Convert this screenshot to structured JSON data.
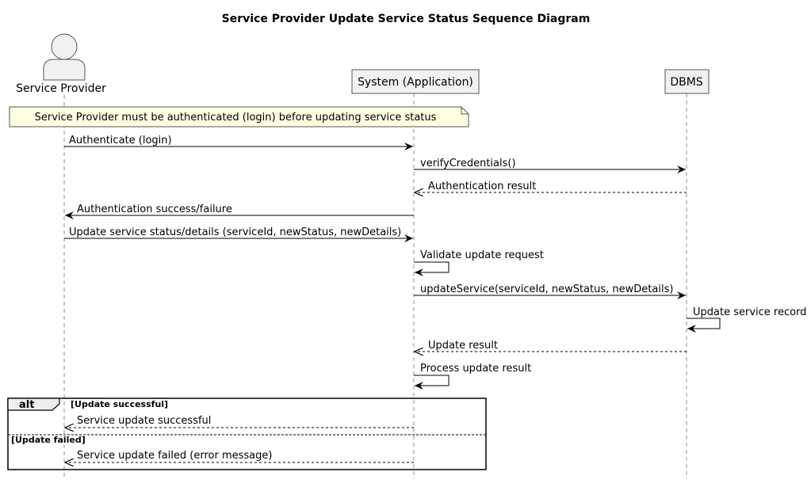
{
  "title": "Service Provider Update Service Status Sequence Diagram",
  "participants": [
    {
      "label": "Service Provider",
      "kind": "actor"
    },
    {
      "label": "System (Application)",
      "kind": "box"
    },
    {
      "label": "DBMS",
      "kind": "box"
    }
  ],
  "note": "Service Provider must be authenticated (login) before updating service status",
  "messages": [
    {
      "label": "Authenticate (login)",
      "from": 0,
      "to": 1,
      "style": "solid"
    },
    {
      "label": "verifyCredentials()",
      "from": 1,
      "to": 2,
      "style": "solid"
    },
    {
      "label": "Authentication result",
      "from": 2,
      "to": 1,
      "style": "dashed"
    },
    {
      "label": "Authentication success/failure",
      "from": 1,
      "to": 0,
      "style": "solid"
    },
    {
      "label": "Update service status/details (serviceId, newStatus, newDetails)",
      "from": 0,
      "to": 1,
      "style": "solid"
    },
    {
      "label": "Validate update request",
      "from": 1,
      "to": 1,
      "style": "self"
    },
    {
      "label": "updateService(serviceId, newStatus, newDetails)",
      "from": 1,
      "to": 2,
      "style": "solid"
    },
    {
      "label": "Update service record",
      "from": 2,
      "to": 2,
      "style": "self"
    },
    {
      "label": "Update result",
      "from": 2,
      "to": 1,
      "style": "dashed"
    },
    {
      "label": "Process update result",
      "from": 1,
      "to": 1,
      "style": "self"
    }
  ],
  "alt": {
    "keyword": "alt",
    "guard1": "[Update successful]",
    "guard2": "[Update failed]",
    "msg1": "Service update successful",
    "msg2": "Service update failed (error message)"
  },
  "colors": {
    "lifeline": "#7ea06a",
    "note_fill": "#fefee0",
    "box_fill": "#f1f1f1",
    "border": "#555555"
  }
}
